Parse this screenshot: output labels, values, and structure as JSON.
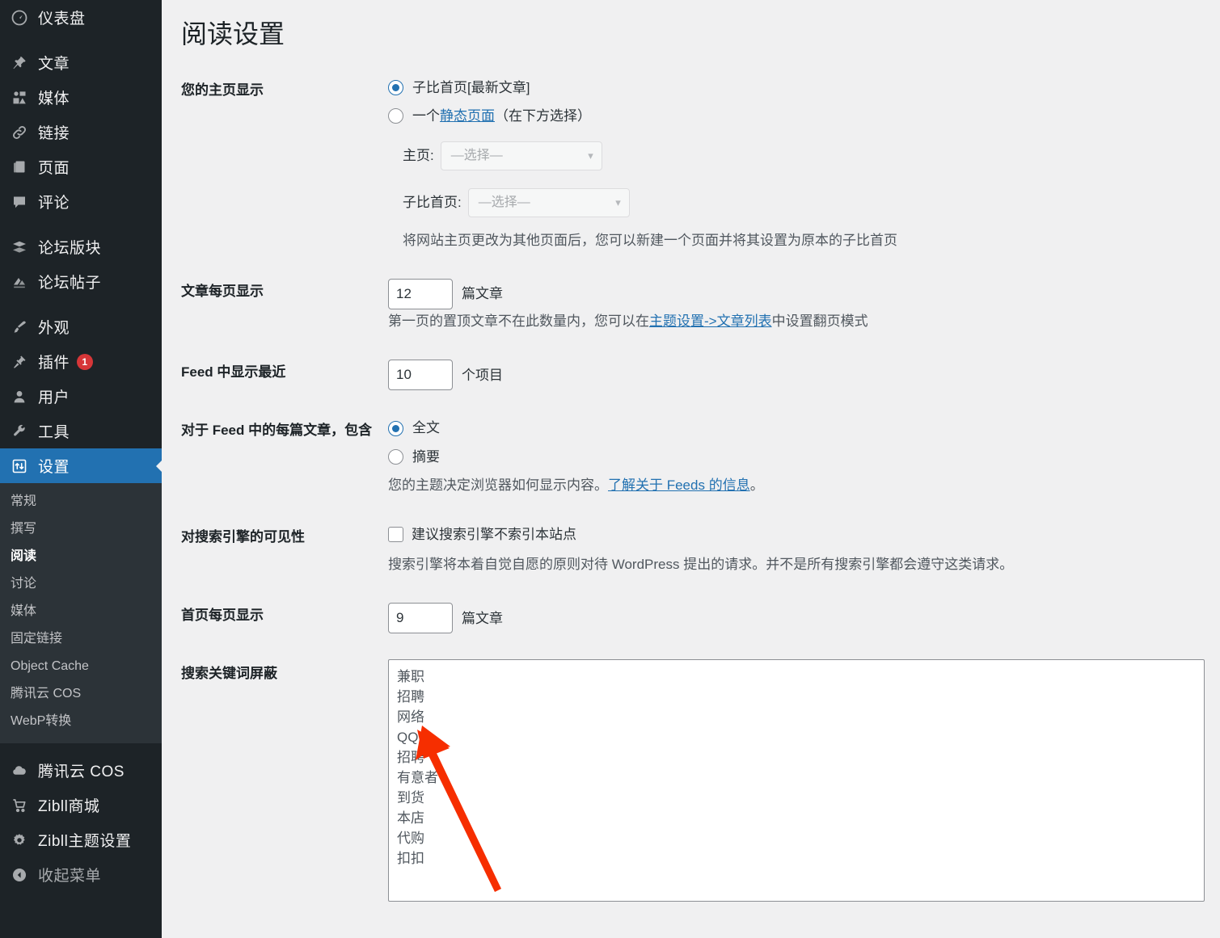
{
  "colors": {
    "sidebar_bg": "#1d2327",
    "submenu_bg": "#2c3338",
    "active_blue": "#2271b1",
    "link_blue": "#2271b1",
    "badge_red": "#d63638",
    "arrow_red": "#f62e00",
    "page_bg": "#f0f0f1"
  },
  "sidebar": {
    "items": [
      {
        "label": "仪表盘",
        "icon": "dashboard-icon"
      },
      {
        "label": "文章",
        "icon": "pin-icon"
      },
      {
        "label": "媒体",
        "icon": "media-icon"
      },
      {
        "label": "链接",
        "icon": "link-icon"
      },
      {
        "label": "页面",
        "icon": "page-icon"
      },
      {
        "label": "评论",
        "icon": "comment-icon"
      },
      {
        "label": "论坛版块",
        "icon": "forum-board-icon"
      },
      {
        "label": "论坛帖子",
        "icon": "forum-topic-icon"
      },
      {
        "label": "外观",
        "icon": "appearance-brush-icon"
      },
      {
        "label": "插件",
        "icon": "plugin-icon",
        "badge": "1"
      },
      {
        "label": "用户",
        "icon": "user-icon"
      },
      {
        "label": "工具",
        "icon": "tools-wrench-icon"
      },
      {
        "label": "设置",
        "icon": "settings-icon",
        "active": true
      }
    ],
    "submenu": [
      {
        "label": "常规"
      },
      {
        "label": "撰写"
      },
      {
        "label": "阅读",
        "current": true
      },
      {
        "label": "讨论"
      },
      {
        "label": "媒体"
      },
      {
        "label": "固定链接"
      },
      {
        "label": "Object Cache"
      },
      {
        "label": "腾讯云 COS"
      },
      {
        "label": "WebP转换"
      }
    ],
    "bottom_items": [
      {
        "label": "腾讯云 COS",
        "icon": "cloud-icon"
      },
      {
        "label": "Zibll商城",
        "icon": "cart-icon"
      },
      {
        "label": "Zibll主题设置",
        "icon": "gear-icon"
      },
      {
        "label": "收起菜单",
        "icon": "collapse-arrow-icon"
      }
    ]
  },
  "page": {
    "title": "阅读设置"
  },
  "sections": {
    "homepage": {
      "label": "您的主页显示",
      "radio_posts": "子比首页[最新文章]",
      "radio_static_prefix": "一个",
      "radio_static_link": "静态页面",
      "radio_static_suffix": "（在下方选择）",
      "selected": "posts",
      "home_label": "主页:",
      "home_value": "—选择—",
      "posts_page_label": "子比首页:",
      "posts_page_value": "—选择—",
      "note": "将网站主页更改为其他页面后，您可以新建一个页面并将其设置为原本的子比首页"
    },
    "posts_per_page": {
      "label": "文章每页显示",
      "value": "12",
      "unit": "篇文章",
      "note_before": "第一页的置顶文章不在此数量内，您可以在",
      "note_link": "主题设置->文章列表",
      "note_after": "中设置翻页模式"
    },
    "feed_items": {
      "label": "Feed 中显示最近",
      "value": "10",
      "unit": "个项目"
    },
    "feed_content": {
      "label": "对于 Feed 中的每篇文章，包含",
      "radio_full": "全文",
      "radio_excerpt": "摘要",
      "selected": "full",
      "note_before": "您的主题决定浏览器如何显示内容。",
      "note_link": "了解关于 Feeds 的信息",
      "note_after": "。"
    },
    "search_visibility": {
      "label": "对搜索引擎的可见性",
      "checkbox_label": "建议搜索引擎不索引本站点",
      "checked": false,
      "note": "搜索引擎将本着自觉自愿的原则对待 WordPress 提出的请求。并不是所有搜索引擎都会遵守这类请求。"
    },
    "home_per_page": {
      "label": "首页每页显示",
      "value": "9",
      "unit": "篇文章"
    },
    "keyword_block": {
      "label": "搜索关键词屏蔽",
      "value": "兼职\n招聘\n网络\nQQ\n招聘\n有意者\n到货\n本店\n代购\n扣扣"
    }
  }
}
